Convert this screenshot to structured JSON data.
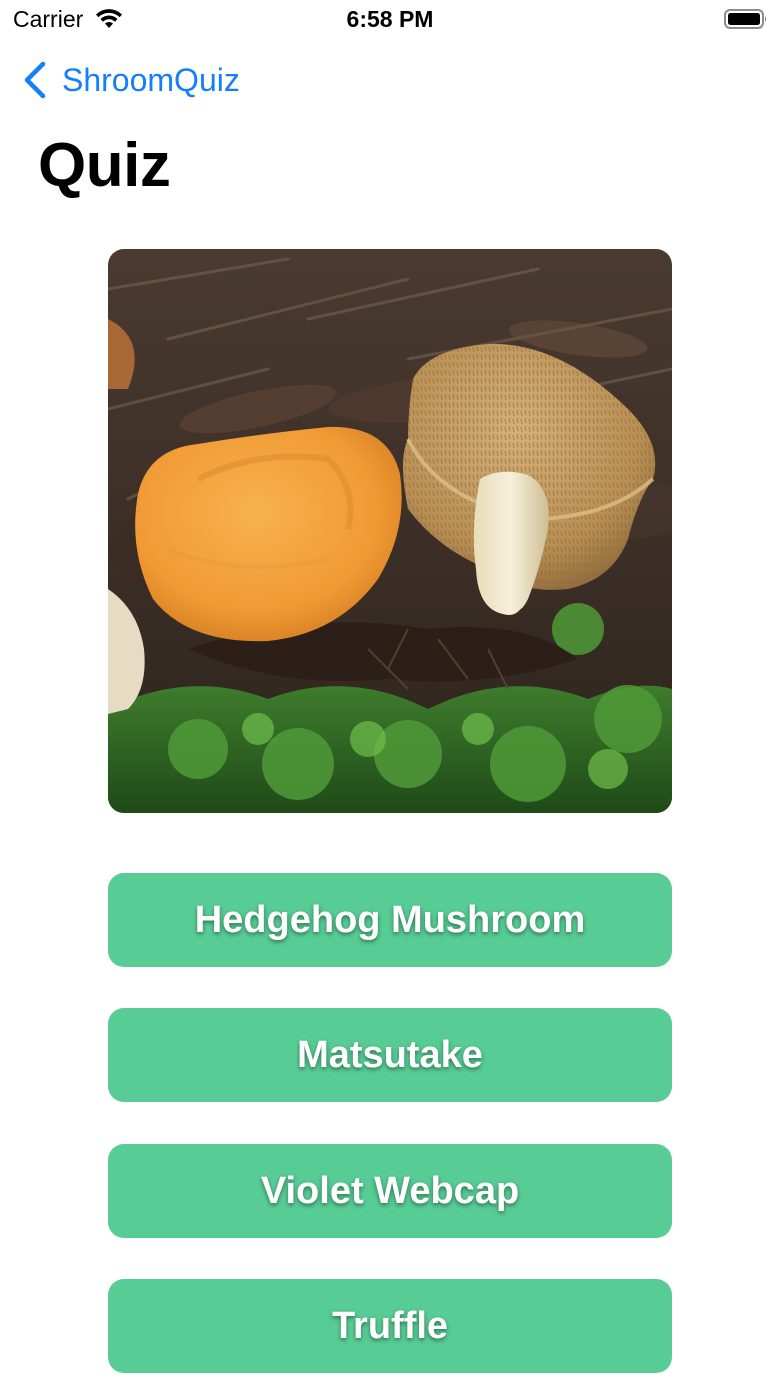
{
  "status_bar": {
    "carrier": "Carrier",
    "time": "6:58 PM"
  },
  "nav": {
    "back_label": "ShroomQuiz"
  },
  "page": {
    "title": "Quiz"
  },
  "quiz": {
    "image_icon": "mushroom-photo",
    "options": [
      {
        "label": "Hedgehog Mushroom"
      },
      {
        "label": "Matsutake"
      },
      {
        "label": "Violet Webcap"
      },
      {
        "label": "Truffle"
      }
    ]
  },
  "colors": {
    "accent": "#157efb",
    "button": "#57cc94",
    "button_text": "#ffffff"
  }
}
